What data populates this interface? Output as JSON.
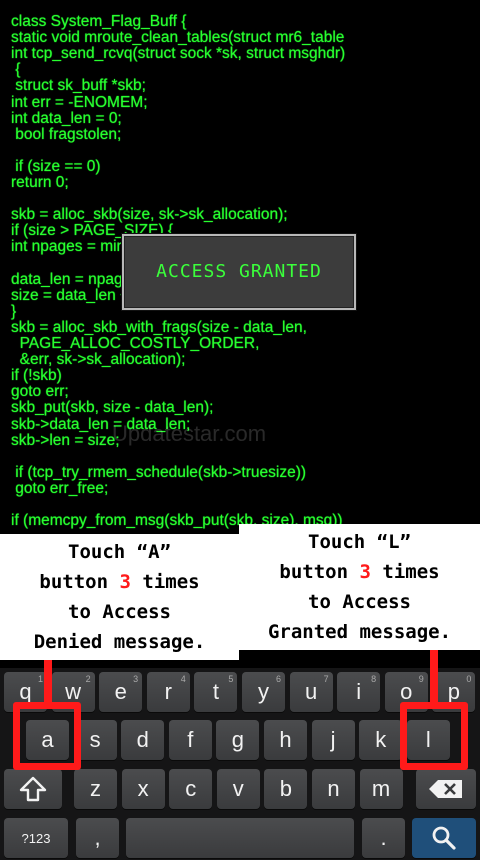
{
  "code_lines": [
    "class System_Flag_Buff {",
    "static void mroute_clean_tables(struct mr6_table",
    "int tcp_send_rcvq(struct sock *sk, struct msghdr)",
    " {",
    " struct sk_buff *skb;",
    "int err = -ENOMEM;",
    "int data_len = 0;",
    " bool fragstolen;",
    "",
    " if (size == 0)",
    "return 0;",
    "",
    "skb = alloc_skb(size, sk->sk_allocation);",
    "if (size > PAGE_SIZE) {",
    "int npages = min_t(size_t, size >> PAGE_SHIFT);",
    "",
    "data_len = npages << PAGE_SHIFT;",
    "size = data_len + (size & ~PAGE_MASK);",
    "}",
    "skb = alloc_skb_with_frags(size - data_len,",
    "  PAGE_ALLOC_COSTLY_ORDER,",
    "  &err, sk->sk_allocation);",
    "if (!skb)",
    "goto err;",
    "skb_put(skb, size - data_len);",
    "skb->data_len = data_len;",
    "skb->len = size;",
    "",
    " if (tcp_try_rmem_schedule(skb->truesize))",
    " goto err_free;",
    "",
    "if (memcpy_from_msg(skb_put(skb, size), msg))"
  ],
  "popup": {
    "text": "ACCESS GRANTED"
  },
  "watermark": "Updatestar.com",
  "callout_a": {
    "l1": "Touch “A”",
    "l2a": "button ",
    "l2num": "3",
    "l2b": " times",
    "l3": "to Access",
    "l4": "Denied message."
  },
  "callout_l": {
    "l1": "Touch “L”",
    "l2a": "button ",
    "l2num": "3",
    "l2b": " times",
    "l3": "to Access",
    "l4": "Granted message."
  },
  "keyboard": {
    "row1": [
      {
        "k": "q",
        "h": "1"
      },
      {
        "k": "w",
        "h": "2"
      },
      {
        "k": "e",
        "h": "3"
      },
      {
        "k": "r",
        "h": "4"
      },
      {
        "k": "t",
        "h": "5"
      },
      {
        "k": "y",
        "h": "6"
      },
      {
        "k": "u",
        "h": "7"
      },
      {
        "k": "i",
        "h": "8"
      },
      {
        "k": "o",
        "h": "9"
      },
      {
        "k": "p",
        "h": "0"
      }
    ],
    "row2": [
      "a",
      "s",
      "d",
      "f",
      "g",
      "h",
      "j",
      "k",
      "l"
    ],
    "row3": [
      "z",
      "x",
      "c",
      "v",
      "b",
      "n",
      "m"
    ],
    "sym_label": "?123",
    "comma_label": ",",
    "period_label": ".",
    "icons": {
      "shift": "shift-arrow-icon",
      "backspace": "backspace-icon",
      "search": "search-icon"
    },
    "accent_color": "#1f4f7a"
  }
}
